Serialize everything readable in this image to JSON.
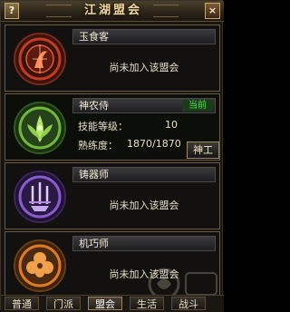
{
  "window": {
    "title": "江湖盟会",
    "help_label": "?",
    "close_label": "×"
  },
  "professions": [
    {
      "name": "玉食客",
      "status": "尚未加入该盟会",
      "emblem": "food-emblem-icon",
      "color": "#c23c24"
    },
    {
      "name": "神农侍",
      "current_badge": "当前",
      "emblem": "herb-emblem-icon",
      "color": "#4c9a2a",
      "skill_label": "技能等级：",
      "skill_value": "10",
      "proficiency_label": "熟练度：",
      "proficiency_value": "1870/1870",
      "action_button": "神工"
    },
    {
      "name": "铸器师",
      "status": "尚未加入该盟会",
      "emblem": "forge-emblem-icon",
      "color": "#6a3aa8"
    },
    {
      "name": "机巧师",
      "status": "尚未加入该盟会",
      "emblem": "mechanism-emblem-icon",
      "color": "#d4731c"
    }
  ],
  "tabs": [
    {
      "label": "普通"
    },
    {
      "label": "门派"
    },
    {
      "label": "盟会",
      "selected": true
    },
    {
      "label": "生活"
    },
    {
      "label": "战斗"
    }
  ]
}
